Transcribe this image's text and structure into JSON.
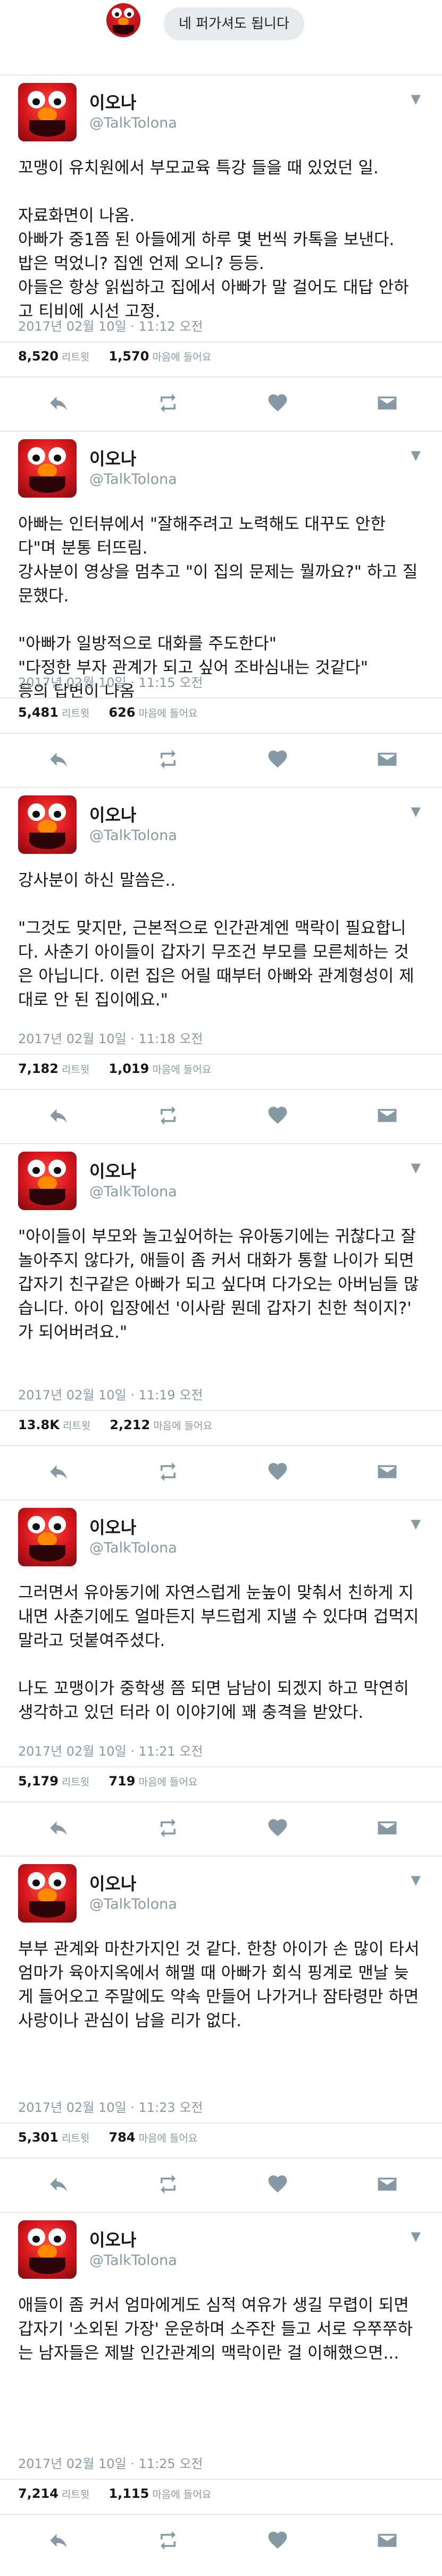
{
  "top": {
    "bubble_text": "네 퍼가셔도 됩니다"
  },
  "tweets": [
    {
      "name": "이오나",
      "handle": "@TalkTolona",
      "text": "꼬맹이 유치원에서 부모교육 특강 들을 때 있었던 일.\n\n자료화면이 나옴.\n아빠가 중1쯤 된 아들에게 하루 몇 번씩 카톡을 보낸다.\n밥은 먹었니? 집엔 언제 오니? 등등.\n아들은 항상 읽씹하고 집에서 아빠가 말 걸어도 대답 안하고 티비에 시선 고정.",
      "time": "2017년 02월 10일 · 11:12 오전",
      "retweets": "8,520",
      "retweets_label": "리트윗",
      "likes": "1,570",
      "likes_label": "마음에 들어요"
    },
    {
      "name": "이오나",
      "handle": "@TalkTolona",
      "text": "아빠는 인터뷰에서 \"잘해주려고 노력해도 대꾸도 안한다\"며 분통 터뜨림.\n강사분이 영상을 멈추고 \"이 집의 문제는 뭘까요?\" 하고 질문했다.\n\n\"아빠가 일방적으로 대화를 주도한다\"\n\"다정한 부자 관계가 되고 싶어 조바심내는 것같다\"\n등의 답변이 나옴",
      "time": "2017년 02월 10일 · 11:15 오전",
      "retweets": "5,481",
      "retweets_label": "리트윗",
      "likes": "626",
      "likes_label": "마음에 들어요"
    },
    {
      "name": "이오나",
      "handle": "@TalkTolona",
      "text": "강사분이 하신 말씀은..\n\n\"그것도 맞지만, 근본적으로 인간관계엔 맥락이 필요합니다. 사춘기 아이들이 갑자기 무조건 부모를 모른체하는 것은 아닙니다. 이런 집은 어릴 때부터 아빠와 관계형성이 제대로 안 된 집이에요.\"",
      "time": "2017년 02월 10일 · 11:18 오전",
      "retweets": "7,182",
      "retweets_label": "리트윗",
      "likes": "1,019",
      "likes_label": "마음에 들어요"
    },
    {
      "name": "이오나",
      "handle": "@TalkTolona",
      "text": "\"아이들이 부모와 놀고싶어하는 유아동기에는 귀찮다고 잘 놀아주지 않다가, 애들이 좀 커서 대화가 통할 나이가 되면 갑자기 친구같은 아빠가 되고 싶다며 다가오는 아버님들 많습니다. 아이 입장에선 '이사람 뭔데 갑자기 친한 척이지?' 가 되어버려요.\"",
      "time": "2017년 02월 10일 · 11:19 오전",
      "retweets": "13.8K",
      "retweets_label": "리트윗",
      "likes": "2,212",
      "likes_label": "마음에 들어요"
    },
    {
      "name": "이오나",
      "handle": "@TalkTolona",
      "text": "그러면서 유아동기에 자연스럽게 눈높이 맞춰서 친하게 지내면 사춘기에도 얼마든지 부드럽게 지낼 수 있다며 겁먹지 말라고 덧붙여주셨다.\n\n나도 꼬맹이가 중학생 쯤 되면 남남이 되겠지 하고 막연히 생각하고 있던 터라 이 이야기에 꽤 충격을 받았다.",
      "time": "2017년 02월 10일 · 11:21 오전",
      "retweets": "5,179",
      "retweets_label": "리트윗",
      "likes": "719",
      "likes_label": "마음에 들어요"
    },
    {
      "name": "이오나",
      "handle": "@TalkTolona",
      "text": "부부 관계와 마찬가지인 것 같다. 한창 아이가 손 많이 타서 엄마가 육아지옥에서 해맬 때 아빠가 회식 핑계로 맨날 늦게 들어오고 주말에도 약속 만들어 나가거나 잠타령만 하면 사랑이나 관심이 남을 리가 없다.",
      "time": "2017년 02월 10일 · 11:23 오전",
      "retweets": "5,301",
      "retweets_label": "리트윗",
      "likes": "784",
      "likes_label": "마음에 들어요"
    },
    {
      "name": "이오나",
      "handle": "@TalkTolona",
      "text": "애들이 좀 커서 엄마에게도 심적 여유가 생길 무렵이 되면 갑자기 '소외된 가장' 운운하며 소주잔 들고 서로 우쭈쭈하는 남자들은 제발 인간관계의 맥락이란 걸 이해했으면...",
      "time": "2017년 02월 10일 · 11:25 오전",
      "retweets": "7,214",
      "retweets_label": "리트윗",
      "likes": "1,115",
      "likes_label": "마음에 들어요"
    }
  ],
  "icons": {
    "caret": "chevron-down-icon",
    "reply": "reply-icon",
    "retweet": "retweet-icon",
    "like": "heart-icon",
    "dm": "envelope-icon"
  },
  "colors": {
    "text": "#14171a",
    "secondary": "#8899a6",
    "divider": "#e1e8ed",
    "avatar_red": "#d4151c"
  }
}
